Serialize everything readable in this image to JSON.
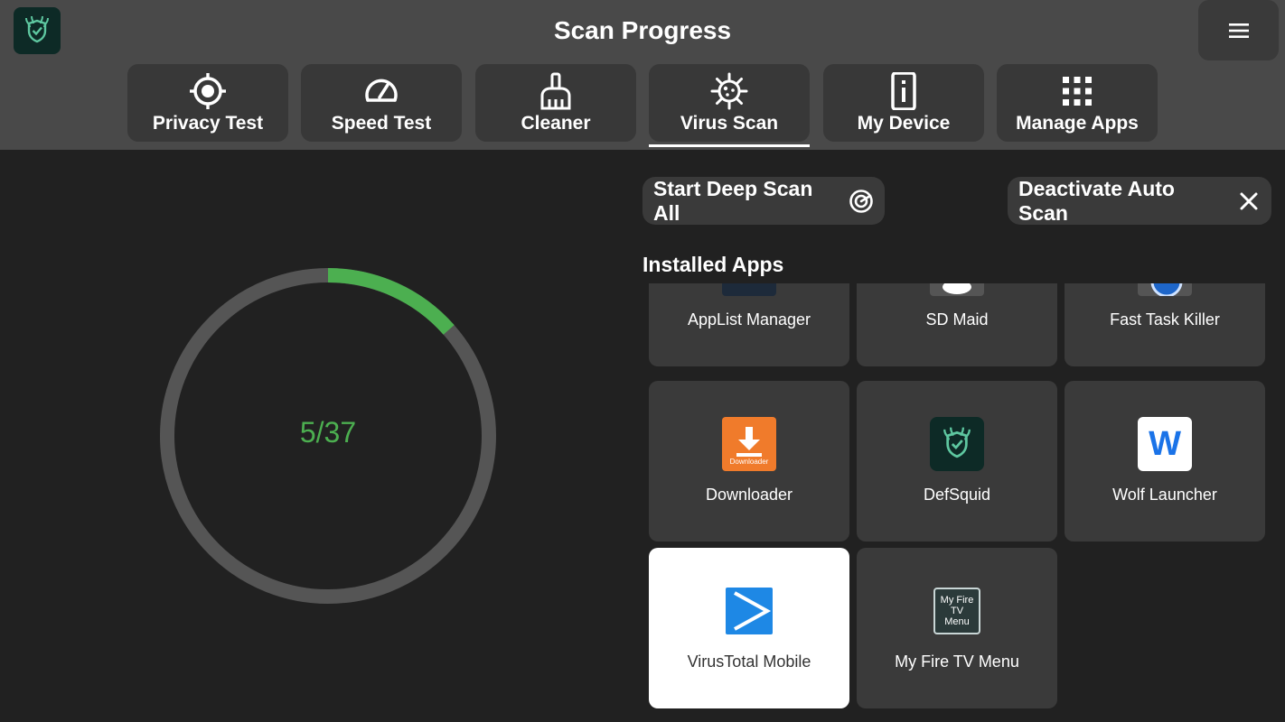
{
  "header": {
    "title": "Scan Progress"
  },
  "tabs": [
    {
      "label": "Privacy Test",
      "icon": "crosshair-icon"
    },
    {
      "label": "Speed Test",
      "icon": "speedometer-icon"
    },
    {
      "label": "Cleaner",
      "icon": "broom-icon"
    },
    {
      "label": "Virus Scan",
      "icon": "virus-icon",
      "active": true
    },
    {
      "label": "My Device",
      "icon": "device-icon"
    },
    {
      "label": "Manage Apps",
      "icon": "grid-icon"
    }
  ],
  "scan": {
    "progress_text": "5/37",
    "scanned": 5,
    "total": 37,
    "ring_color": "#4caf50",
    "track_color": "#555555"
  },
  "actions": {
    "deep_scan_label": "Start Deep Scan All",
    "deactivate_label": "Deactivate Auto Scan"
  },
  "apps_section": {
    "title": "Installed Apps",
    "apps": [
      {
        "label": "AppList Manager",
        "icon": "applist-manager-icon"
      },
      {
        "label": "SD Maid",
        "icon": "sd-maid-icon"
      },
      {
        "label": "Fast Task Killer",
        "icon": "fast-task-killer-icon"
      },
      {
        "label": "Downloader",
        "icon": "downloader-icon",
        "icon_text": "Downloader",
        "color": "#f07b2b"
      },
      {
        "label": "DefSquid",
        "icon": "defsquid-icon",
        "color": "#0d2a26"
      },
      {
        "label": "Wolf Launcher",
        "icon": "wolf-launcher-icon",
        "icon_text": "W",
        "color": "#1a73e8"
      },
      {
        "label": "VirusTotal Mobile",
        "icon": "virustotal-icon",
        "color": "#1e88e5",
        "selected": true
      },
      {
        "label": "My Fire TV Menu",
        "icon": "fire-tv-menu-icon",
        "icon_text": "My Fire TV Menu"
      }
    ]
  },
  "colors": {
    "topbar": "#494949",
    "background": "#212121",
    "accent_green": "#4caf50"
  }
}
